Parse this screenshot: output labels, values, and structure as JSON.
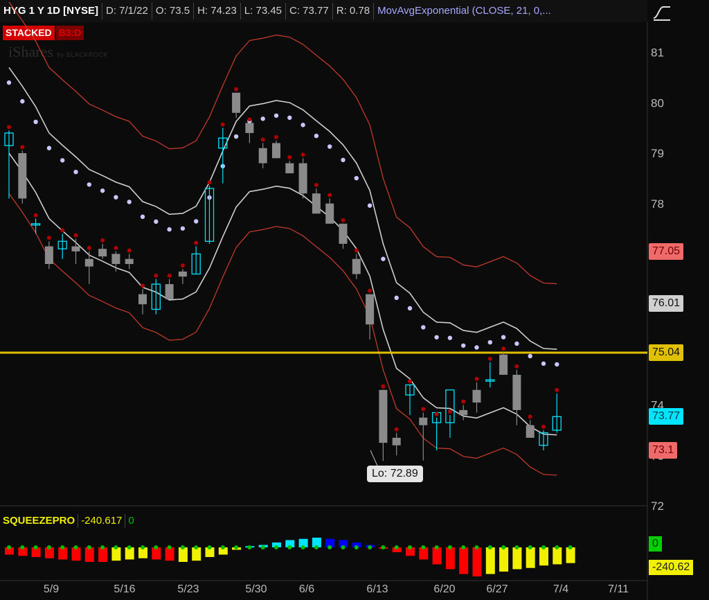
{
  "header": {
    "symbol": "HYG 1 Y 1D [NYSE]",
    "date": "D: 7/1/22",
    "open": "O: 73.5",
    "high": "H: 74.23",
    "low": "L: 73.45",
    "close": "C: 73.77",
    "range": "R: 0.78",
    "ma_study": "MovAvgExponential (CLOSE, 21, 0,..."
  },
  "badges": {
    "stacked": "STACKED",
    "b3d": "B3:D"
  },
  "watermark": {
    "brand": "iShares",
    "by": "by BLACKROCK"
  },
  "price_axis": {
    "ticks": [
      {
        "label": "81",
        "value": 81
      },
      {
        "label": "80",
        "value": 80
      },
      {
        "label": "79",
        "value": 79
      },
      {
        "label": "78",
        "value": 78
      },
      {
        "label": "74",
        "value": 74
      },
      {
        "label": "73",
        "value": 73
      },
      {
        "label": "72",
        "value": 72
      }
    ]
  },
  "price_tags": [
    {
      "label": "77.05",
      "value": 77.05,
      "bg": "#f06a6a",
      "fg": "#6b0000"
    },
    {
      "label": "76.01",
      "value": 76.01,
      "bg": "#d0d0d0",
      "fg": "#111111"
    },
    {
      "label": "75.04",
      "value": 75.04,
      "bg": "#e0c000",
      "fg": "#111111"
    },
    {
      "label": "73.77",
      "value": 73.77,
      "bg": "#00e5ff",
      "fg": "#003a44"
    },
    {
      "label": "73.1",
      "value": 73.1,
      "bg": "#f06a6a",
      "fg": "#6b0000"
    }
  ],
  "horizontal_line": {
    "value": 75.04,
    "color": "#e0c000"
  },
  "lo_callout": {
    "label": "Lo: 72.89",
    "value": 72.89
  },
  "date_axis": [
    "5/9",
    "5/16",
    "5/23",
    "5/30",
    "6/6",
    "6/13",
    "6/20",
    "6/27",
    "7/4",
    "7/11"
  ],
  "lower": {
    "name": "SQUEEZEPRO",
    "value": "-240.617",
    "zero_label": "0",
    "tag_zero": "0",
    "tag_value": "-240.62"
  },
  "colors": {
    "up_candle": "#00e5ff",
    "down_candle": "#8a8a8a",
    "dot": "#c8c8ff",
    "ema_red": "#c0392b",
    "ema_gray": "#cfcfcf",
    "marker": "#b00000"
  },
  "chart_data": {
    "type": "candlestick",
    "x": [
      "5/2",
      "5/3",
      "5/4",
      "5/5",
      "5/6",
      "5/9",
      "5/10",
      "5/11",
      "5/12",
      "5/13",
      "5/16",
      "5/17",
      "5/18",
      "5/19",
      "5/20",
      "5/23",
      "5/24",
      "5/25",
      "5/26",
      "5/27",
      "5/31",
      "6/1",
      "6/2",
      "6/3",
      "6/6",
      "6/7",
      "6/8",
      "6/9",
      "6/10",
      "6/13",
      "6/14",
      "6/15",
      "6/16",
      "6/17",
      "6/21",
      "6/22",
      "6/23",
      "6/24",
      "6/27",
      "6/28",
      "6/29",
      "6/30",
      "7/1"
    ],
    "ohlc": [
      [
        79.15,
        79.45,
        78.1,
        79.4
      ],
      [
        79.0,
        79.05,
        78.0,
        78.1
      ],
      [
        77.6,
        77.7,
        77.4,
        77.6
      ],
      [
        77.15,
        77.25,
        76.7,
        76.8
      ],
      [
        77.1,
        77.4,
        76.9,
        77.25
      ],
      [
        77.15,
        77.3,
        76.8,
        77.05
      ],
      [
        76.9,
        77.05,
        76.4,
        76.75
      ],
      [
        77.1,
        77.2,
        76.9,
        76.95
      ],
      [
        77.0,
        77.05,
        76.65,
        76.8
      ],
      [
        76.9,
        77.0,
        76.7,
        76.8
      ],
      [
        76.2,
        76.3,
        75.8,
        76.0
      ],
      [
        75.9,
        76.5,
        75.8,
        76.4
      ],
      [
        76.4,
        76.5,
        76.1,
        76.1
      ],
      [
        76.65,
        76.7,
        76.4,
        76.55
      ],
      [
        76.6,
        77.15,
        76.6,
        77.0
      ],
      [
        77.25,
        78.35,
        77.2,
        78.3
      ],
      [
        79.1,
        79.5,
        78.4,
        79.3
      ],
      [
        80.2,
        80.2,
        79.7,
        79.8
      ],
      [
        79.6,
        79.6,
        79.2,
        79.4
      ],
      [
        79.1,
        79.2,
        78.7,
        78.8
      ],
      [
        79.2,
        79.25,
        78.9,
        78.9
      ],
      [
        78.8,
        78.85,
        78.6,
        78.6
      ],
      [
        78.8,
        78.9,
        78.1,
        78.2
      ],
      [
        78.2,
        78.3,
        77.8,
        77.8
      ],
      [
        78.0,
        78.1,
        77.6,
        77.6
      ],
      [
        77.6,
        77.6,
        77.1,
        77.2
      ],
      [
        76.9,
        77.0,
        76.5,
        76.6
      ],
      [
        76.2,
        76.2,
        75.3,
        75.6
      ],
      [
        74.3,
        74.3,
        72.89,
        73.25
      ],
      [
        73.35,
        73.45,
        73.0,
        73.2
      ],
      [
        74.2,
        74.4,
        73.8,
        74.4
      ],
      [
        73.75,
        73.85,
        72.9,
        73.6
      ],
      [
        73.65,
        73.75,
        73.1,
        73.85
      ],
      [
        73.65,
        73.8,
        73.35,
        74.3
      ],
      [
        73.9,
        74.0,
        73.7,
        73.8
      ],
      [
        74.3,
        74.45,
        73.85,
        74.05
      ],
      [
        74.5,
        74.85,
        74.35,
        74.5
      ],
      [
        75.0,
        75.05,
        74.6,
        74.6
      ],
      [
        74.6,
        74.7,
        73.6,
        73.9
      ],
      [
        73.6,
        73.7,
        73.35,
        73.35
      ],
      [
        73.2,
        73.5,
        73.1,
        73.45
      ],
      [
        73.5,
        74.23,
        73.45,
        73.77
      ]
    ],
    "ylim": [
      72,
      81.6
    ]
  }
}
